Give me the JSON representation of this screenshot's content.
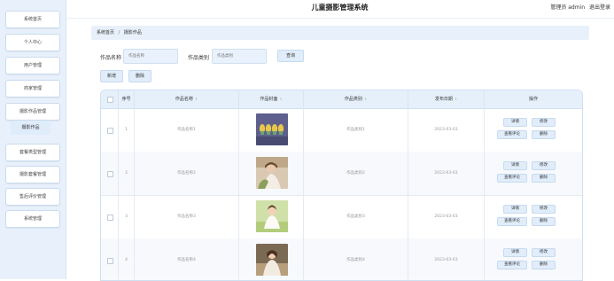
{
  "header": {
    "title": "儿童摄影管理系统",
    "user_label": "管理员 admin",
    "logout_label": "退出登录"
  },
  "sidebar": {
    "items": [
      {
        "label": "系统首页"
      },
      {
        "label": "个人中心"
      },
      {
        "label": "用户管理"
      },
      {
        "label": "商家管理"
      },
      {
        "label": "摄影作品管理"
      },
      {
        "label": "套餐类型管理"
      },
      {
        "label": "摄影套餐管理"
      },
      {
        "label": "售后评价管理"
      },
      {
        "label": "系统管理"
      }
    ],
    "active_sub": "摄影作品"
  },
  "breadcrumb": {
    "home": "系统首页",
    "separator": "/",
    "current": "摄影作品"
  },
  "search": {
    "name_label": "作品名称",
    "name_placeholder": "作品名称",
    "type_label": "作品类别",
    "type_placeholder": "作品类别",
    "search_button": "查询"
  },
  "toolbar": {
    "add_label": "新增",
    "delete_label": "删除"
  },
  "table": {
    "columns": [
      "序号",
      "作品名称",
      "作品封面",
      "作品类别",
      "发布日期",
      "操作"
    ],
    "rows": [
      {
        "index": "1",
        "name": "作品名称1",
        "type": "作品类别1",
        "date": "2023-03-03"
      },
      {
        "index": "2",
        "name": "作品名称2",
        "type": "作品类别2",
        "date": "2023-03-03"
      },
      {
        "index": "3",
        "name": "作品名称3",
        "type": "作品类别3",
        "date": "2023-03-03"
      },
      {
        "index": "4",
        "name": "作品名称4",
        "type": "作品类别4",
        "date": "2023-03-03"
      }
    ],
    "actions": {
      "detail": "详情",
      "edit": "修改",
      "review": "查看评论",
      "delete": "删除"
    }
  },
  "colors": {
    "accent": "#e1edfa",
    "sidebar_bg": "#e8f1fb",
    "header_bg": "#e6f0fb"
  }
}
